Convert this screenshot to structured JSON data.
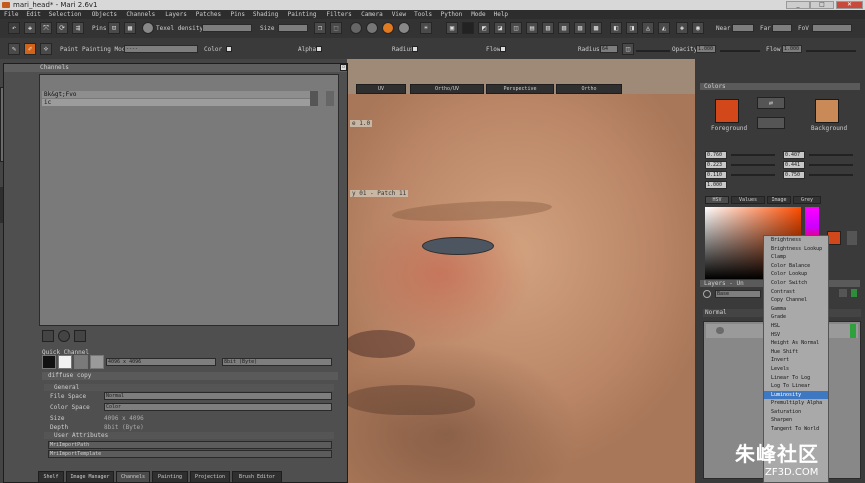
{
  "window": {
    "title": "mari_head* - Mari 2.6v1",
    "min": "_",
    "max": "□",
    "close": "✕"
  },
  "menu": [
    "File",
    "Edit",
    "Selection",
    "Objects",
    "Channels",
    "Layers",
    "Patches",
    "Pins",
    "Shading",
    "Painting",
    "Filters",
    "Camera",
    "View",
    "Tools",
    "Python",
    "Mode",
    "Help"
  ],
  "toolbar1": {
    "pins": "Pins",
    "texel_density": "Texel density",
    "size": "Size",
    "nearl": "Near",
    "farl": "Far",
    "fov": "FoV"
  },
  "toolbar2": {
    "paint": "Paint",
    "painting_mode": "Painting Mode",
    "painting_mode_value": "----",
    "color": "Color",
    "alpha": "Alpha",
    "radius": "Radius",
    "flow": "Flow",
    "radius2": "Radius",
    "radius_value": "64",
    "opacity": "Opacity",
    "opacity_value": "1.000",
    "flow2": "Flow",
    "flow_value": "1.000"
  },
  "channels_panel": {
    "title": "Channels",
    "items": [
      "Bk&gt;Fvo",
      "ic"
    ],
    "quick_channel": "Quick Channel",
    "qc_size": "4096 x 4096",
    "qc_depth": "8bit (Byte)",
    "diffuse_title": "diffuse copy",
    "general": "General",
    "file_space": "File Space",
    "file_space_value": "Normal",
    "color_space": "Color Space",
    "color_space_value": "Color",
    "size": "Size",
    "size_value": "4096 x 4096",
    "depth": "Depth",
    "depth_value": "8bit (Byte)",
    "user_attrs": "User Attributes",
    "attr1": "MriImportPath",
    "attr2": "MriImportTemplate"
  },
  "left_tabs": [
    "Shelf",
    "Image Manager",
    "Channels",
    "Painting",
    "Projection",
    "Brush Editor"
  ],
  "viewport_tabs": [
    "UV",
    "Ortho/UV",
    "Perspective",
    "Ortho"
  ],
  "viewport_labels": {
    "l1": "e 1.0",
    "l2": "y 01 - Patch 11"
  },
  "colors": {
    "title": "Colors",
    "foreground": "Foreground",
    "background": "Background",
    "fg_hex": "#d2481a",
    "bg_hex": "#c98a57",
    "r": "0.760",
    "g": "0.223",
    "b": "0.110",
    "a": "1.000",
    "r2": "0.407",
    "g2": "0.441",
    "b2": "0.750"
  },
  "color_tabs": [
    "HSV",
    "Values",
    "Image",
    "Grey"
  ],
  "layers": {
    "title": "Layers - Un",
    "blend": "Base",
    "normal": "Normal"
  },
  "context_menu": [
    "Brightness",
    "Brightness Lookup",
    "Clamp",
    "Color Balance",
    "Color Lookup",
    "Color Switch",
    "Contrast",
    "Copy Channel",
    "Gamma",
    "Grade",
    "HSL",
    "HSV",
    "Height As Normal",
    "Hue Shift",
    "Invert",
    "Levels",
    "Linear To Log",
    "Log To Linear",
    "Luminosity",
    "Premultiply Alpha",
    "Saturation",
    "Sharpen",
    "Tangent To World"
  ],
  "context_highlight": "Luminosity",
  "watermark": {
    "brand": "朱峰社区",
    "site": "ZF3D.COM"
  }
}
